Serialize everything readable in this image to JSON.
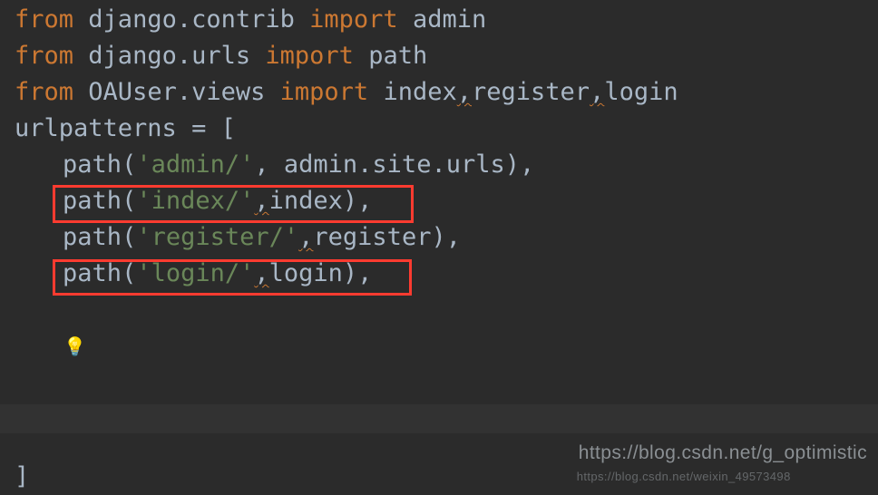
{
  "code": {
    "l1": {
      "kw1": "from",
      "mod": "django.contrib",
      "kw2": "import",
      "name": "admin"
    },
    "l2": {
      "kw1": "from",
      "mod": "django.urls",
      "kw2": "import",
      "name": "path"
    },
    "l3": {
      "kw1": "from",
      "mod": "OAUser.views",
      "kw2": "import",
      "names": "index",
      "names2": "register",
      "names3": "login"
    },
    "l4": {
      "var": "urlpatterns",
      "eq": " = ["
    },
    "l5": {
      "indent": "    ",
      "fn": "path",
      "open": "(",
      "str": "'admin/'",
      "sep": ", ",
      "arg": "admin.site.urls",
      "close": "),"
    },
    "l6": {
      "indent": "    ",
      "fn": "path",
      "open": "(",
      "str": "'index/'",
      "sep": ",",
      "arg": "index",
      "close": "),"
    },
    "l7": {
      "indent": "    ",
      "fn": "path",
      "open": "(",
      "str": "'register/'",
      "sep": ",",
      "arg": "register",
      "close": "),"
    },
    "l8": {
      "indent": "    ",
      "fn": "path",
      "open": "(",
      "str": "'login/'",
      "sep": ",",
      "arg": "login",
      "close": "),"
    },
    "l10": {
      "close": "]"
    }
  },
  "icons": {
    "bulb": "💡"
  },
  "watermark": {
    "main": "https://blog.csdn.net/g_optimistic",
    "sub": "https://blog.csdn.net/weixin_49573498"
  }
}
